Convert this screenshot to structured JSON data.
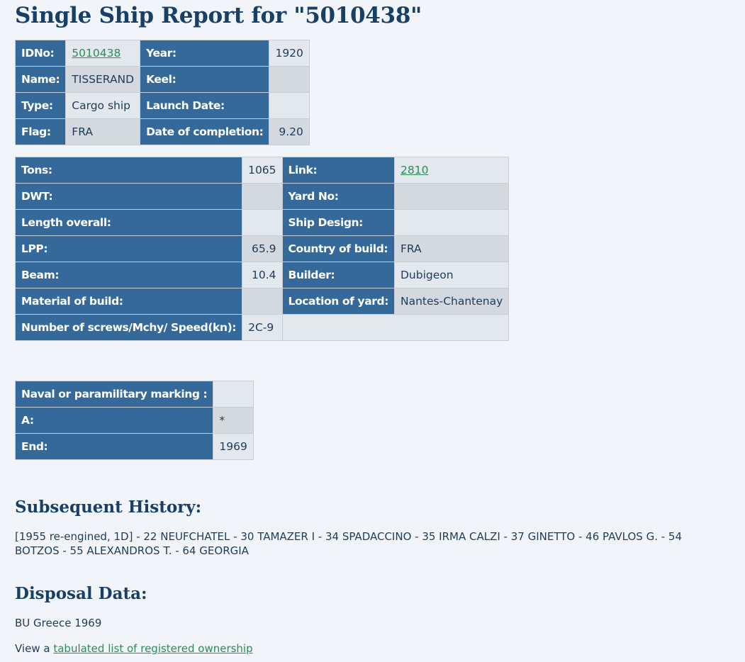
{
  "page_title": "Single Ship Report for \"5010438\"",
  "table1": {
    "rows": [
      {
        "l1": "IDNo:",
        "v1": "5010438",
        "l2": "Year:",
        "v2": "1920"
      },
      {
        "l1": "Name:",
        "v1": "TISSERAND",
        "l2": "Keel:",
        "v2": ""
      },
      {
        "l1": "Type:",
        "v1": "Cargo ship",
        "l2": "Launch Date:",
        "v2": ""
      },
      {
        "l1": "Flag:",
        "v1": "FRA",
        "l2": "Date of completion:",
        "v2": "9.20"
      }
    ]
  },
  "table2": {
    "rows": [
      {
        "l1": "Tons:",
        "v1": "1065",
        "l2": "Link:",
        "v2": "2810"
      },
      {
        "l1": "DWT:",
        "v1": "",
        "l2": "Yard No:",
        "v2": ""
      },
      {
        "l1": "Length overall:",
        "v1": "",
        "l2": "Ship Design:",
        "v2": ""
      },
      {
        "l1": "LPP:",
        "v1": "65.9",
        "l2": "Country of build:",
        "v2": "FRA"
      },
      {
        "l1": "Beam:",
        "v1": "10.4",
        "l2": "Builder:",
        "v2": "Dubigeon"
      },
      {
        "l1": "Material of build:",
        "v1": "",
        "l2": "Location of yard:",
        "v2": "Nantes-Chantenay"
      }
    ],
    "screws_label": "Number of screws/Mchy/ Speed(kn):",
    "screws_value": "2C-9"
  },
  "table3": {
    "rows": [
      {
        "label": "Naval or paramilitary marking :",
        "value": ""
      },
      {
        "label": "A:",
        "value": "*"
      },
      {
        "label": "End:",
        "value": "1969"
      }
    ]
  },
  "history": {
    "heading": "Subsequent History:",
    "text": "[1955 re-engined, 1D] - 22 NEUFCHATEL - 30 TAMAZER I - 34 SPADACCINO - 35 IRMA CALZI - 37 GINETTO - 46 PAVLOS G. - 54 BOTZOS - 55 ALEXANDROS T. - 64 GEORGIA"
  },
  "disposal": {
    "heading": "Disposal Data:",
    "text": "BU Greece 1969",
    "view_prefix": "View a",
    "view_link": "tabulated list of registered ownership"
  }
}
